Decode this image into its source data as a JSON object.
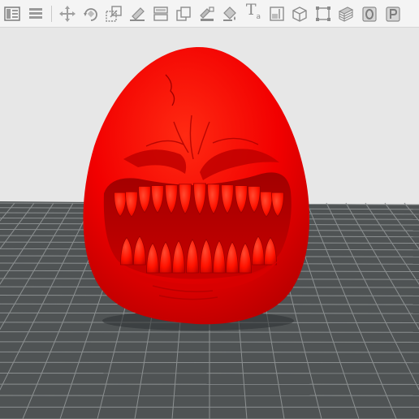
{
  "toolbar": {
    "buttons": [
      {
        "icon": "layout-panel-icon",
        "interactable": true
      },
      {
        "icon": "layers-list-icon",
        "interactable": true
      },
      {
        "icon": "move-arrows-icon",
        "interactable": true
      },
      {
        "icon": "rotate-icon",
        "interactable": true
      },
      {
        "icon": "scale-icon",
        "interactable": true
      },
      {
        "icon": "place-on-bed-icon",
        "interactable": true
      },
      {
        "icon": "split-icon",
        "interactable": true
      },
      {
        "icon": "arrange-icon",
        "interactable": true
      },
      {
        "icon": "support-paint-icon",
        "interactable": true
      },
      {
        "icon": "color-paint-icon",
        "interactable": true
      },
      {
        "icon": "text-tool-icon",
        "interactable": true,
        "label": "T",
        "sub": "a"
      },
      {
        "icon": "measure-icon",
        "interactable": true
      },
      {
        "icon": "cube-icon",
        "interactable": true
      },
      {
        "icon": "fit-view-icon",
        "interactable": true
      },
      {
        "icon": "layers-stack-icon",
        "interactable": true
      },
      {
        "icon": "zero-icon",
        "interactable": true
      },
      {
        "icon": "preview-icon",
        "interactable": true
      }
    ]
  },
  "viewport": {
    "background_color": "#e7e7e7",
    "bed_color": "#4f5354",
    "grid_color": "#8c9091",
    "model_color": "#ff0000",
    "model_shadow_color": "#b00000",
    "model_name": "monster-egg-model"
  }
}
